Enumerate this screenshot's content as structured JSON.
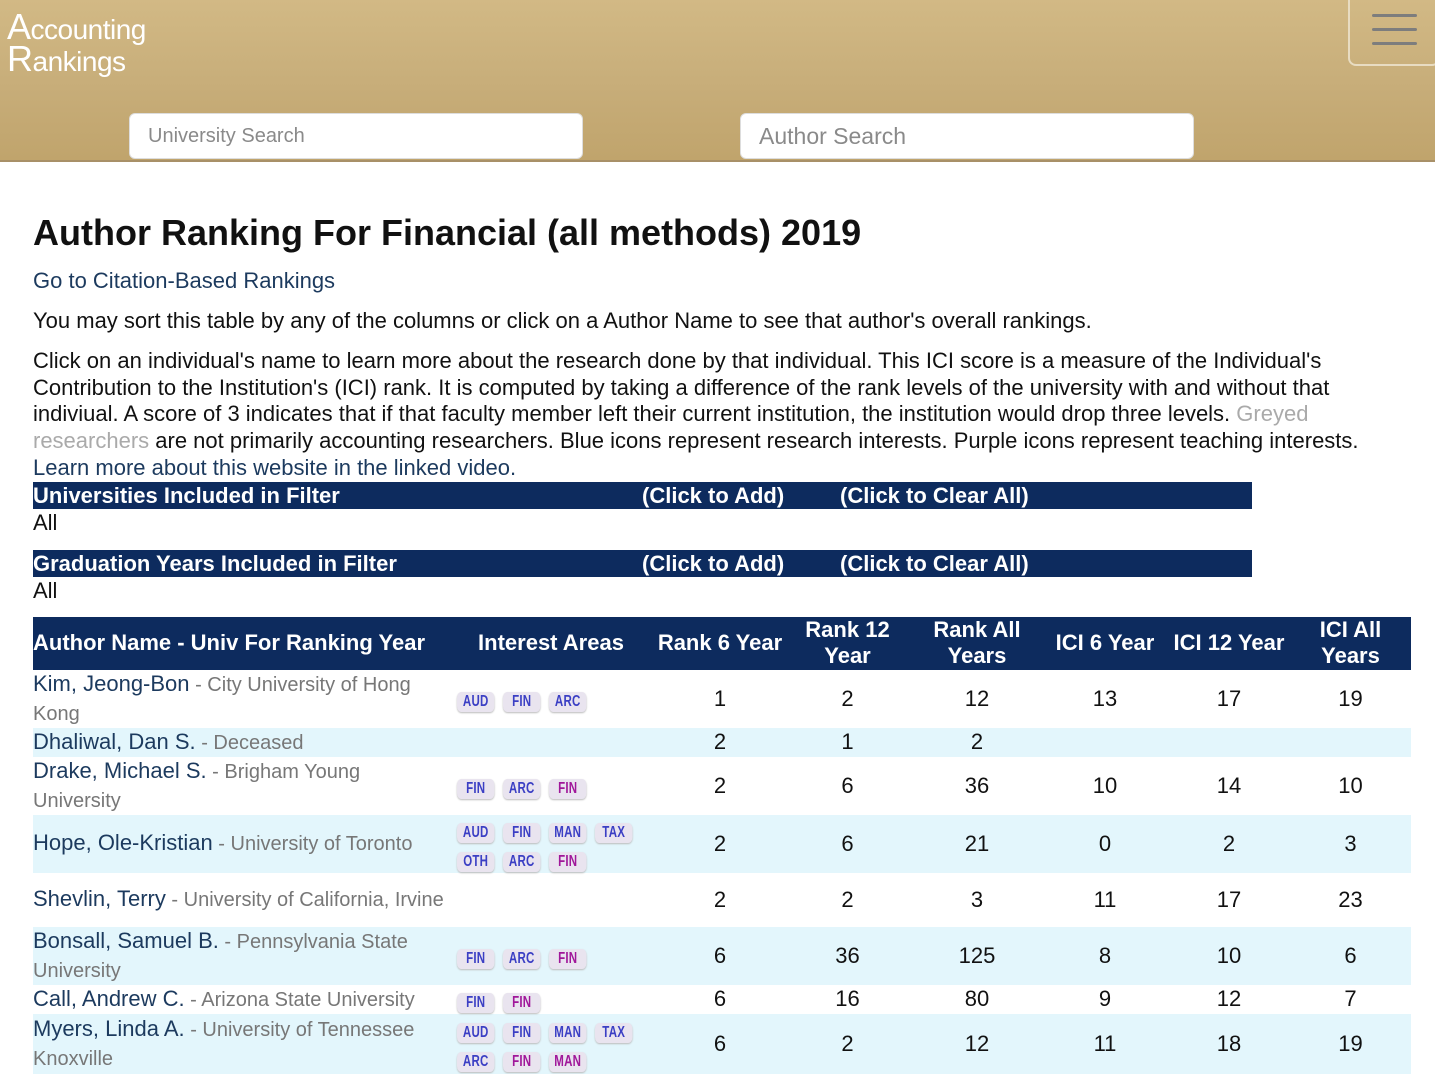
{
  "header": {
    "logo_line1_cap": "A",
    "logo_line1_rest": "ccounting",
    "logo_line2_cap": "R",
    "logo_line2_rest": "ankings",
    "university_search_placeholder": "University Search",
    "author_search_placeholder": "Author Search",
    "menu_icon": "hamburger-menu-icon"
  },
  "page": {
    "title": "Author Ranking For Financial (all methods) 2019",
    "citation_link": "Go to Citation-Based Rankings",
    "sort_text": "You may sort this table by any of the columns or click on a Author Name to see that author's overall rankings.",
    "info_text_1": "Click on an individual's name to learn more about the research done by that individual. This ICI score is a measure of the Individual's Contribution to the Institution's (ICI) rank. It is computed by taking a difference of the rank levels of the university with and without that indiviual. A score of 3 indicates that if that faculty member left their current institution, the institution would drop three levels. ",
    "info_grey": "Greyed researchers",
    "info_text_2": " are not primarily accounting researchers. Blue icons represent research interests. Purple icons represent teaching interests. ",
    "video_link": "Learn more about this website in the linked video."
  },
  "filters": {
    "universities": {
      "title": "Universities Included in Filter",
      "add": "(Click to Add)",
      "clear": "(Click to Clear All)",
      "value": "All"
    },
    "grad_years": {
      "title": "Graduation Years Included in Filter",
      "add": "(Click to Add)",
      "clear": "(Click to Clear All)",
      "value": "All"
    }
  },
  "table": {
    "headers": [
      "Author Name - Univ For Ranking Year",
      "Interest Areas",
      "Rank 6 Year",
      "Rank 12 Year",
      "Rank All Years",
      "ICI 6 Year",
      "ICI 12 Year",
      "ICI All Years"
    ],
    "rows": [
      {
        "author": "Kim, Jeong-Bon",
        "univ": " - City University of Hong Kong",
        "research": [
          "AUD",
          "FIN",
          "ARC"
        ],
        "teaching": [],
        "r6": "1",
        "r12": "2",
        "rall": "12",
        "i6": "13",
        "i12": "17",
        "iall": "19"
      },
      {
        "author": "Dhaliwal, Dan S.",
        "univ": " - Deceased",
        "research": [],
        "teaching": [],
        "r6": "2",
        "r12": "1",
        "rall": "2",
        "i6": "",
        "i12": "",
        "iall": ""
      },
      {
        "author": "Drake, Michael S.",
        "univ": " - Brigham Young University",
        "research": [
          "FIN",
          "ARC"
        ],
        "teaching": [
          "FIN"
        ],
        "r6": "2",
        "r12": "6",
        "rall": "36",
        "i6": "10",
        "i12": "14",
        "iall": "10"
      },
      {
        "author": "Hope, Ole-Kristian",
        "univ": " - University of Toronto",
        "research": [
          "AUD",
          "FIN",
          "MAN",
          "TAX",
          "OTH",
          "ARC"
        ],
        "teaching": [
          "FIN"
        ],
        "r6": "2",
        "r12": "6",
        "rall": "21",
        "i6": "0",
        "i12": "2",
        "iall": "3"
      },
      {
        "author": "Shevlin, Terry",
        "univ": " - University of California, Irvine",
        "research": [],
        "teaching": [],
        "r6": "2",
        "r12": "2",
        "rall": "3",
        "i6": "11",
        "i12": "17",
        "iall": "23"
      },
      {
        "author": "Bonsall, Samuel B.",
        "univ": " - Pennsylvania State University",
        "research": [
          "FIN",
          "ARC"
        ],
        "teaching": [
          "FIN"
        ],
        "r6": "6",
        "r12": "36",
        "rall": "125",
        "i6": "8",
        "i12": "10",
        "iall": "6"
      },
      {
        "author": "Call, Andrew C.",
        "univ": " - Arizona State University",
        "research": [
          "FIN"
        ],
        "teaching": [
          "FIN"
        ],
        "r6": "6",
        "r12": "16",
        "rall": "80",
        "i6": "9",
        "i12": "12",
        "iall": "7"
      },
      {
        "author": "Myers, Linda A.",
        "univ": " - University of Tennessee Knoxville",
        "research": [
          "AUD",
          "FIN",
          "MAN",
          "TAX",
          "ARC"
        ],
        "teaching": [
          "FIN",
          "MAN"
        ],
        "r6": "6",
        "r12": "2",
        "rall": "12",
        "i6": "11",
        "i12": "18",
        "iall": "19"
      }
    ]
  }
}
